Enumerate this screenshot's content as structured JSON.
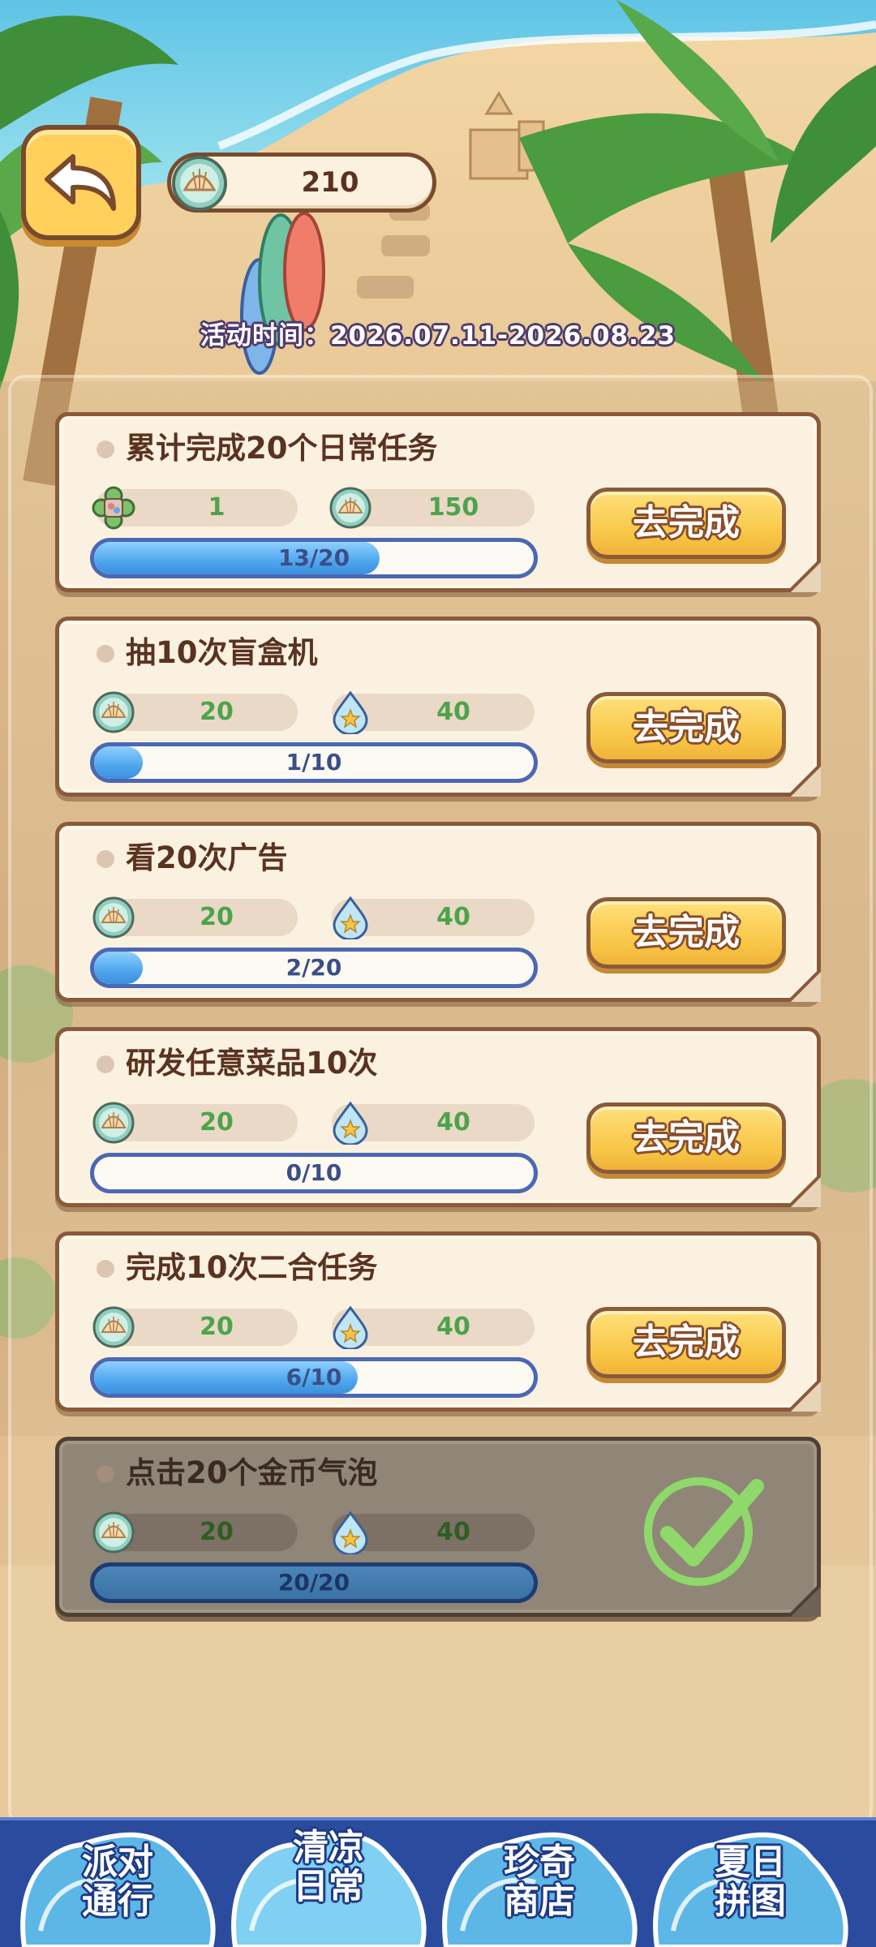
{
  "header": {
    "currency_amount": "210",
    "event_time": "活动时间：2026.07.11-2026.08.23"
  },
  "tasks": [
    {
      "title": "累计完成20个日常任务",
      "reward1": {
        "icon": "puzzle-clover-icon",
        "value": "1"
      },
      "reward2": {
        "icon": "shell-coin-icon",
        "value": "150"
      },
      "progress_text": "13/20",
      "progress_fraction": 0.65,
      "button_label": "去完成",
      "done": false
    },
    {
      "title": "抽10次盲盒机",
      "reward1": {
        "icon": "shell-coin-icon",
        "value": "20"
      },
      "reward2": {
        "icon": "star-drop-icon",
        "value": "40"
      },
      "progress_text": "1/10",
      "progress_fraction": 0.1,
      "button_label": "去完成",
      "done": false
    },
    {
      "title": "看20次广告",
      "reward1": {
        "icon": "shell-coin-icon",
        "value": "20"
      },
      "reward2": {
        "icon": "star-drop-icon",
        "value": "40"
      },
      "progress_text": "2/20",
      "progress_fraction": 0.1,
      "button_label": "去完成",
      "done": false
    },
    {
      "title": "研发任意菜品10次",
      "reward1": {
        "icon": "shell-coin-icon",
        "value": "20"
      },
      "reward2": {
        "icon": "star-drop-icon",
        "value": "40"
      },
      "progress_text": "0/10",
      "progress_fraction": 0,
      "button_label": "去完成",
      "done": false
    },
    {
      "title": "完成10次二合任务",
      "reward1": {
        "icon": "shell-coin-icon",
        "value": "20"
      },
      "reward2": {
        "icon": "star-drop-icon",
        "value": "40"
      },
      "progress_text": "6/10",
      "progress_fraction": 0.6,
      "button_label": "去完成",
      "done": false
    },
    {
      "title": "点击20个金币气泡",
      "reward1": {
        "icon": "shell-coin-icon",
        "value": "20"
      },
      "reward2": {
        "icon": "star-drop-icon",
        "value": "40"
      },
      "progress_text": "20/20",
      "progress_fraction": 1,
      "button_label": "",
      "done": true
    }
  ],
  "nav": {
    "tabs": [
      {
        "line1": "派对",
        "line2": "通行",
        "active": false
      },
      {
        "line1": "清凉",
        "line2": "日常",
        "active": true
      },
      {
        "line1": "珍奇",
        "line2": "商店",
        "active": false
      },
      {
        "line1": "夏日",
        "line2": "拼图",
        "active": false
      }
    ]
  },
  "colors": {
    "brown_outline": "#8a5a3a",
    "button_yellow": "#f7c545",
    "progress_blue": "#4ea6ee",
    "reward_green": "#4ea34a",
    "nav_blue": "#2b4c9e"
  }
}
